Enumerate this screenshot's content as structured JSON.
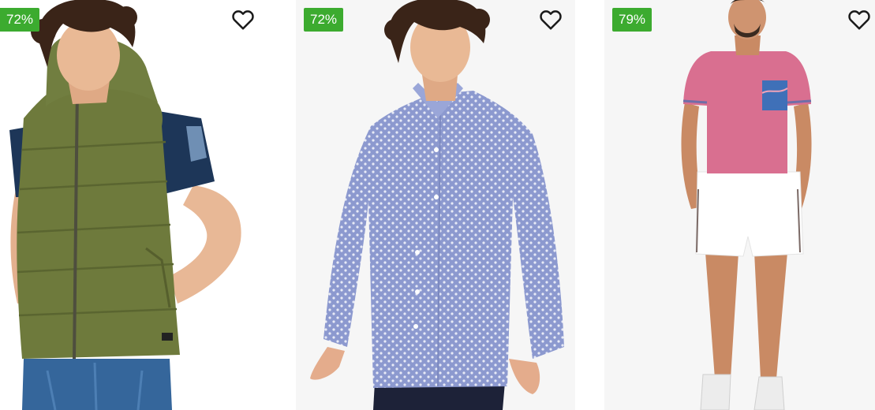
{
  "products": [
    {
      "discount": "72%",
      "icon": "heart-outline-icon",
      "image": "olive-green-hooded-puffer-vest"
    },
    {
      "discount": "72%",
      "icon": "heart-outline-icon",
      "image": "blue-printed-long-sleeve-shirt"
    },
    {
      "discount": "79%",
      "icon": "heart-outline-icon",
      "image": "pink-tshirt-with-white-shorts"
    }
  ],
  "colors": {
    "badge": "#3cab2f",
    "badge_text": "#ffffff",
    "card_bg": "#f6f6f6"
  }
}
